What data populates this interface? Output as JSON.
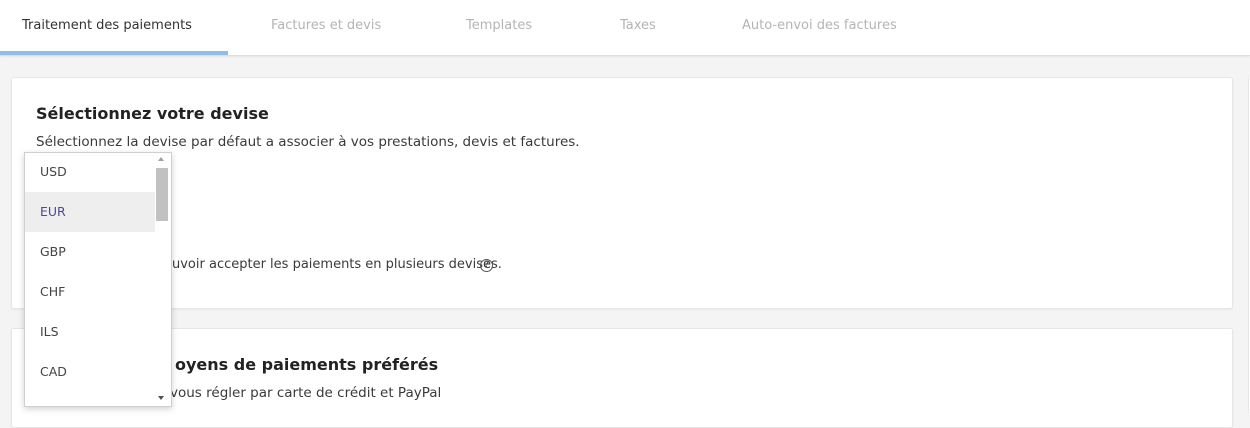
{
  "tabs": [
    {
      "label": "Traitement des paiements",
      "active": true
    },
    {
      "label": "Factures et devis",
      "active": false
    },
    {
      "label": "Templates",
      "active": false
    },
    {
      "label": "Taxes",
      "active": false
    },
    {
      "label": "Auto-envoi des factures",
      "active": false
    }
  ],
  "currency_card": {
    "title": "Sélectionnez votre devise",
    "description": "Sélectionnez la devise par défaut a associer à vos prestations, devis et factures.",
    "multi_currency_text": "uvoir accepter les paiements en plusieurs devises.",
    "help_icon": "question-circle-icon"
  },
  "payment_card": {
    "title": "oyens de paiements préférés",
    "description": "vous régler par carte de crédit et PayPal"
  },
  "currency_dropdown": {
    "options": [
      "USD",
      "EUR",
      "GBP",
      "CHF",
      "ILS",
      "CAD"
    ],
    "selected": "EUR"
  },
  "colors": {
    "active_tab_underline": "#8fbde6",
    "selected_option_text": "#4a4a9a",
    "selected_option_bg": "#eeeeee"
  }
}
